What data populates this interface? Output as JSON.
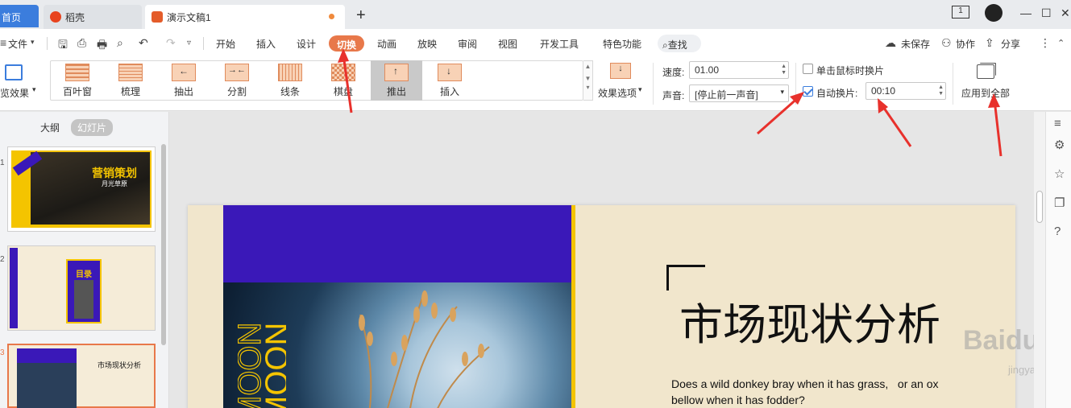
{
  "tabs": {
    "home": "首页",
    "daoke": "稻壳",
    "doc": "演示文稿1",
    "plus": "+"
  },
  "window": {
    "page_count": "1"
  },
  "menu": {
    "file": "文件",
    "items": [
      "开始",
      "插入",
      "设计",
      "切换",
      "动画",
      "放映",
      "审阅",
      "视图",
      "开发工具",
      "特色功能"
    ],
    "search": "查找",
    "unsaved": "未保存",
    "collab": "协作",
    "share": "分享"
  },
  "ribbon": {
    "preview": "览效果",
    "effects": [
      "百叶窗",
      "梳理",
      "抽出",
      "分割",
      "线条",
      "棋盘",
      "推出",
      "插入"
    ],
    "selected_effect": "推出",
    "effect_options": "效果选项",
    "speed_label": "速度:",
    "speed_value": "01.00",
    "sound_label": "声音:",
    "sound_value": "[停止前一声音]",
    "click_advance_label": "单击鼠标时换片",
    "auto_advance_label": "自动换片:",
    "auto_advance_time": "00:10",
    "apply_all": "应用到全部"
  },
  "left_panel": {
    "tab_outline": "大纲",
    "tab_slides": "幻灯片",
    "slides": [
      {
        "num": "1",
        "title": "营销策划",
        "subtitle": "月光草原"
      },
      {
        "num": "2",
        "title": "目录"
      },
      {
        "num": "3",
        "title": "市场现状分析"
      }
    ]
  },
  "slide": {
    "vertical_text": "MOON",
    "title": "市场现状分析",
    "body": "Does a wild donkey bray when it has grass,   or an ox bellow when it has fodder?"
  },
  "watermark": {
    "brand": "Baidu 经验",
    "url": "jingyan.baidu.com"
  },
  "colors": {
    "accent_orange": "#e8784a",
    "slide_purple": "#3a18b8",
    "slide_yellow": "#f4c400",
    "arrow_red": "#e8312c"
  }
}
